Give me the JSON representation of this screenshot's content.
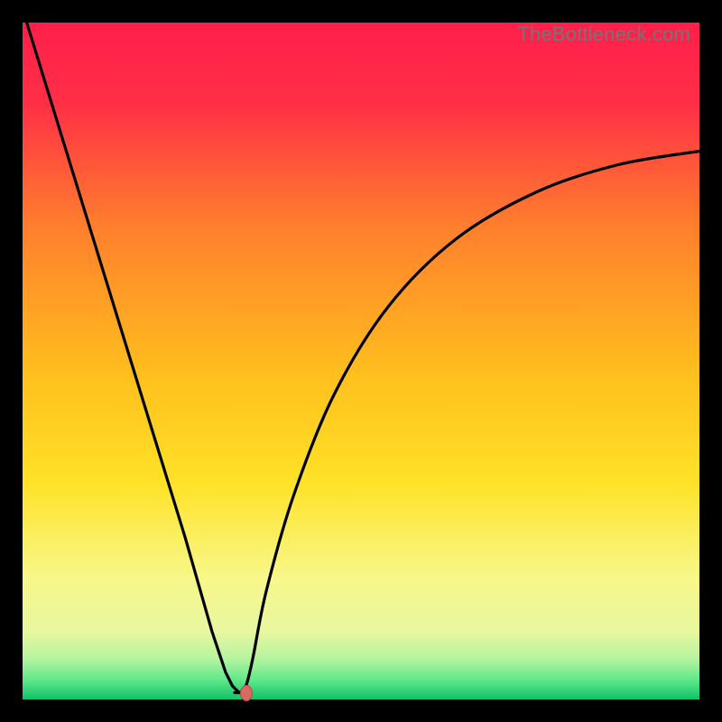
{
  "watermark": "TheBottleneck.com",
  "colors": {
    "top": "#ff1f4b",
    "mid_upper": "#ff7e2d",
    "mid": "#ffd21f",
    "mid_lower": "#f6f98b",
    "green_pale": "#c7f6a5",
    "green": "#2fe67c",
    "green_deep": "#0fbf63",
    "curve": "#000000",
    "marker": "#d86a62",
    "frame_bg": "#ffffff",
    "outer_bg": "#000000"
  },
  "chart_data": {
    "type": "line",
    "title": "",
    "xlabel": "",
    "ylabel": "",
    "xlim": [
      0,
      100
    ],
    "ylim": [
      0,
      100
    ],
    "notes": "V-shaped bottleneck curve on a vertical red→yellow→green gradient. Minimum near x≈32. No axes, ticks, or legend are shown.",
    "x": [
      0,
      4,
      8,
      12,
      16,
      20,
      24,
      28,
      30,
      31,
      32,
      33,
      34,
      36,
      40,
      46,
      54,
      64,
      76,
      88,
      100
    ],
    "values": [
      102,
      89,
      76,
      63,
      50,
      37,
      24,
      10,
      4,
      2,
      1,
      2,
      6,
      16,
      30,
      45,
      58,
      68,
      75,
      79,
      81
    ],
    "min_point": {
      "x": 32,
      "y": 1
    },
    "marker": {
      "x": 33,
      "y": 1
    }
  }
}
